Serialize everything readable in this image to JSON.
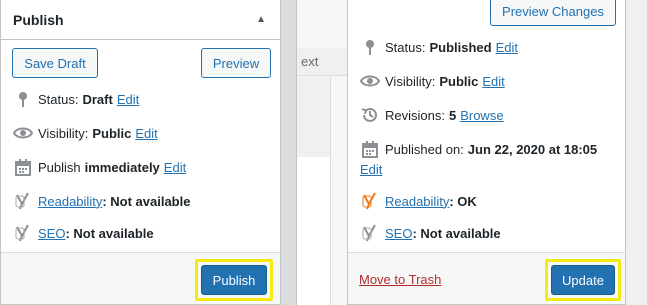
{
  "left": {
    "title": "Publish",
    "save_draft_label": "Save Draft",
    "preview_label": "Preview",
    "status_label": "Status:",
    "status_value": "Draft",
    "status_edit": "Edit",
    "visibility_label": "Visibility:",
    "visibility_value": "Public",
    "visibility_edit": "Edit",
    "publish_label": "Publish",
    "publish_value": "immediately",
    "publish_edit": "Edit",
    "readability_link": "Readability",
    "readability_value": ": Not available",
    "seo_link": "SEO",
    "seo_value": ": Not available",
    "publish_button": "Publish"
  },
  "middle": {
    "tab_fragment": "ext"
  },
  "right": {
    "preview_changes_label": "Preview Changes",
    "status_label": "Status:",
    "status_value": "Published",
    "status_edit": "Edit",
    "visibility_label": "Visibility:",
    "visibility_value": "Public",
    "visibility_edit": "Edit",
    "revisions_label": "Revisions:",
    "revisions_value": "5",
    "revisions_browse": "Browse",
    "published_on_label": "Published on:",
    "published_on_value": "Jun 22, 2020 at 18:05",
    "published_on_edit": "Edit",
    "readability_link": "Readability",
    "readability_value": ": OK",
    "seo_link": "SEO",
    "seo_value": ": Not available",
    "trash_link": "Move to Trash",
    "update_button": "Update"
  },
  "colors": {
    "primary": "#2271b1",
    "highlight": "#f5ea14",
    "trash": "#b32d2e",
    "readability_ok": "#ee7c1b"
  },
  "icons": {
    "status": "pin-icon",
    "visibility": "eye-icon",
    "schedule": "calendar-icon",
    "revisions": "history-icon",
    "yoast": "yoast-y-icon",
    "toggle": "triangle-up-icon"
  }
}
